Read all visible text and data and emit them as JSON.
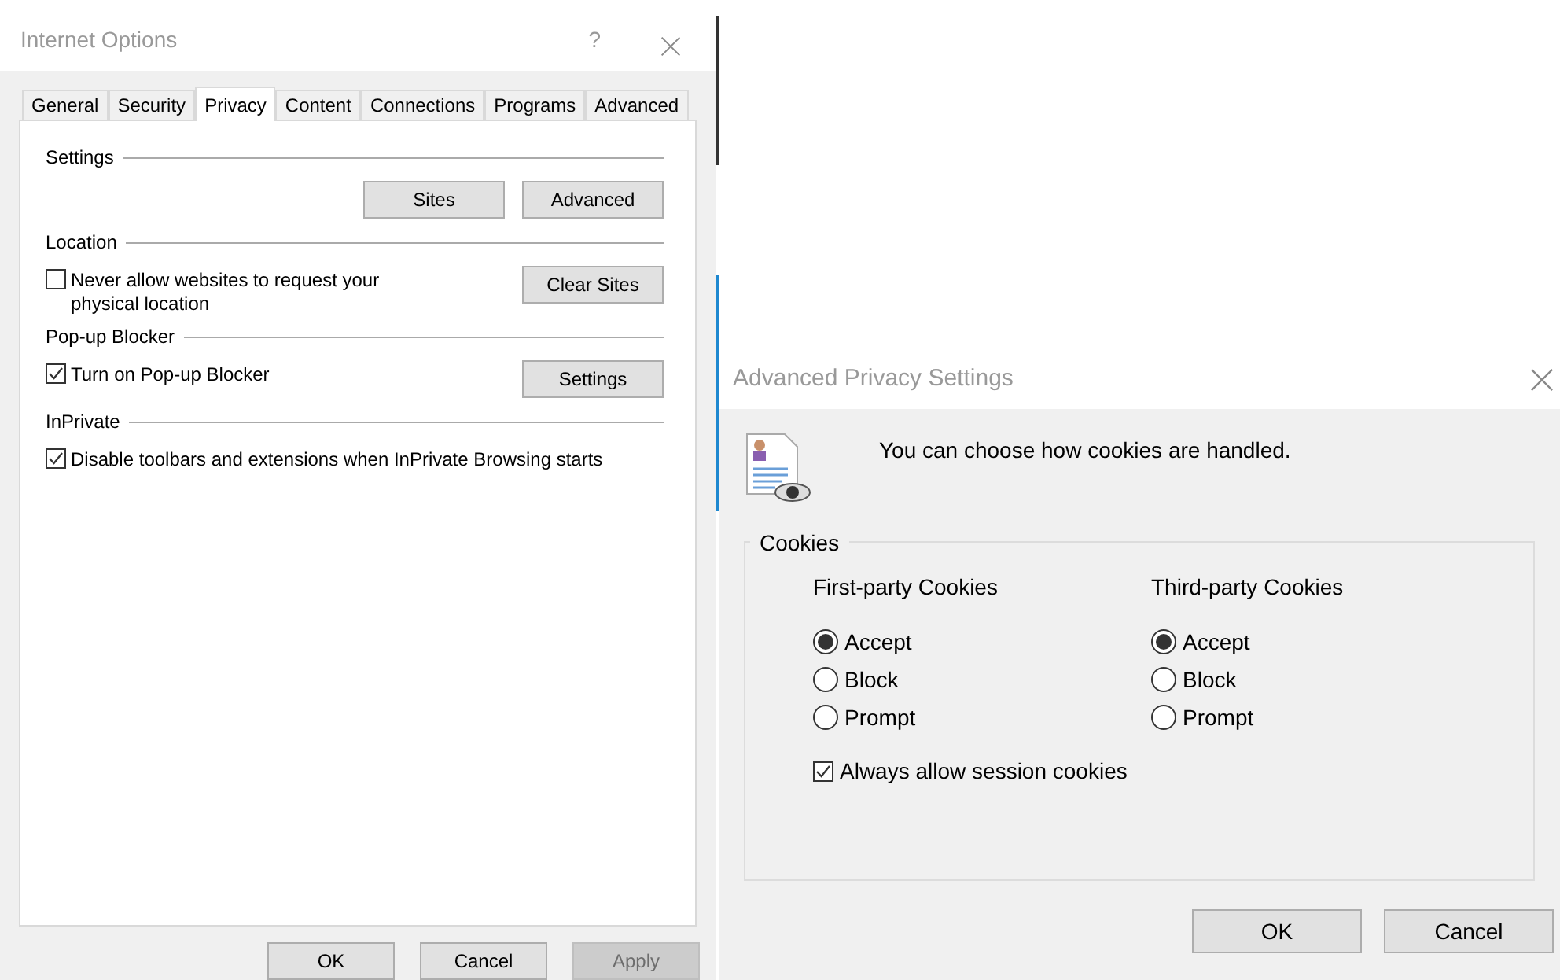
{
  "internet_options": {
    "title": "Internet Options",
    "help": "?",
    "tabs": [
      {
        "label": "General",
        "selected": false
      },
      {
        "label": "Security",
        "selected": false
      },
      {
        "label": "Privacy",
        "selected": true
      },
      {
        "label": "Content",
        "selected": false
      },
      {
        "label": "Connections",
        "selected": false
      },
      {
        "label": "Programs",
        "selected": false
      },
      {
        "label": "Advanced",
        "selected": false
      }
    ],
    "sections": [
      {
        "title": "Settings",
        "buttons": [
          "Sites",
          "Advanced"
        ]
      },
      {
        "title": "Location",
        "checkbox": {
          "label": "Never allow websites to request your physical location",
          "checked": false
        },
        "buttons": [
          "Clear Sites"
        ]
      },
      {
        "title": "Pop-up Blocker",
        "checkbox": {
          "label": "Turn on Pop-up Blocker",
          "checked": true
        },
        "buttons": [
          "Settings"
        ]
      },
      {
        "title": "InPrivate",
        "checkbox": {
          "label": "Disable toolbars and extensions when InPrivate Browsing starts",
          "checked": true
        }
      }
    ],
    "footer_buttons": [
      {
        "label": "OK",
        "disabled": false
      },
      {
        "label": "Cancel",
        "disabled": false
      },
      {
        "label": "Apply",
        "disabled": true
      }
    ]
  },
  "advanced_privacy": {
    "title": "Advanced Privacy Settings",
    "message": "You can choose how cookies are handled.",
    "group": "Cookies",
    "columns": [
      {
        "heading": "First-party Cookies",
        "options": [
          {
            "label": "Accept",
            "selected": true
          },
          {
            "label": "Block",
            "selected": false
          },
          {
            "label": "Prompt",
            "selected": false
          }
        ]
      },
      {
        "heading": "Third-party Cookies",
        "options": [
          {
            "label": "Accept",
            "selected": true
          },
          {
            "label": "Block",
            "selected": false
          },
          {
            "label": "Prompt",
            "selected": false
          }
        ]
      }
    ],
    "session": {
      "label": "Always allow session cookies",
      "checked": true
    },
    "buttons": [
      "OK",
      "Cancel"
    ]
  }
}
